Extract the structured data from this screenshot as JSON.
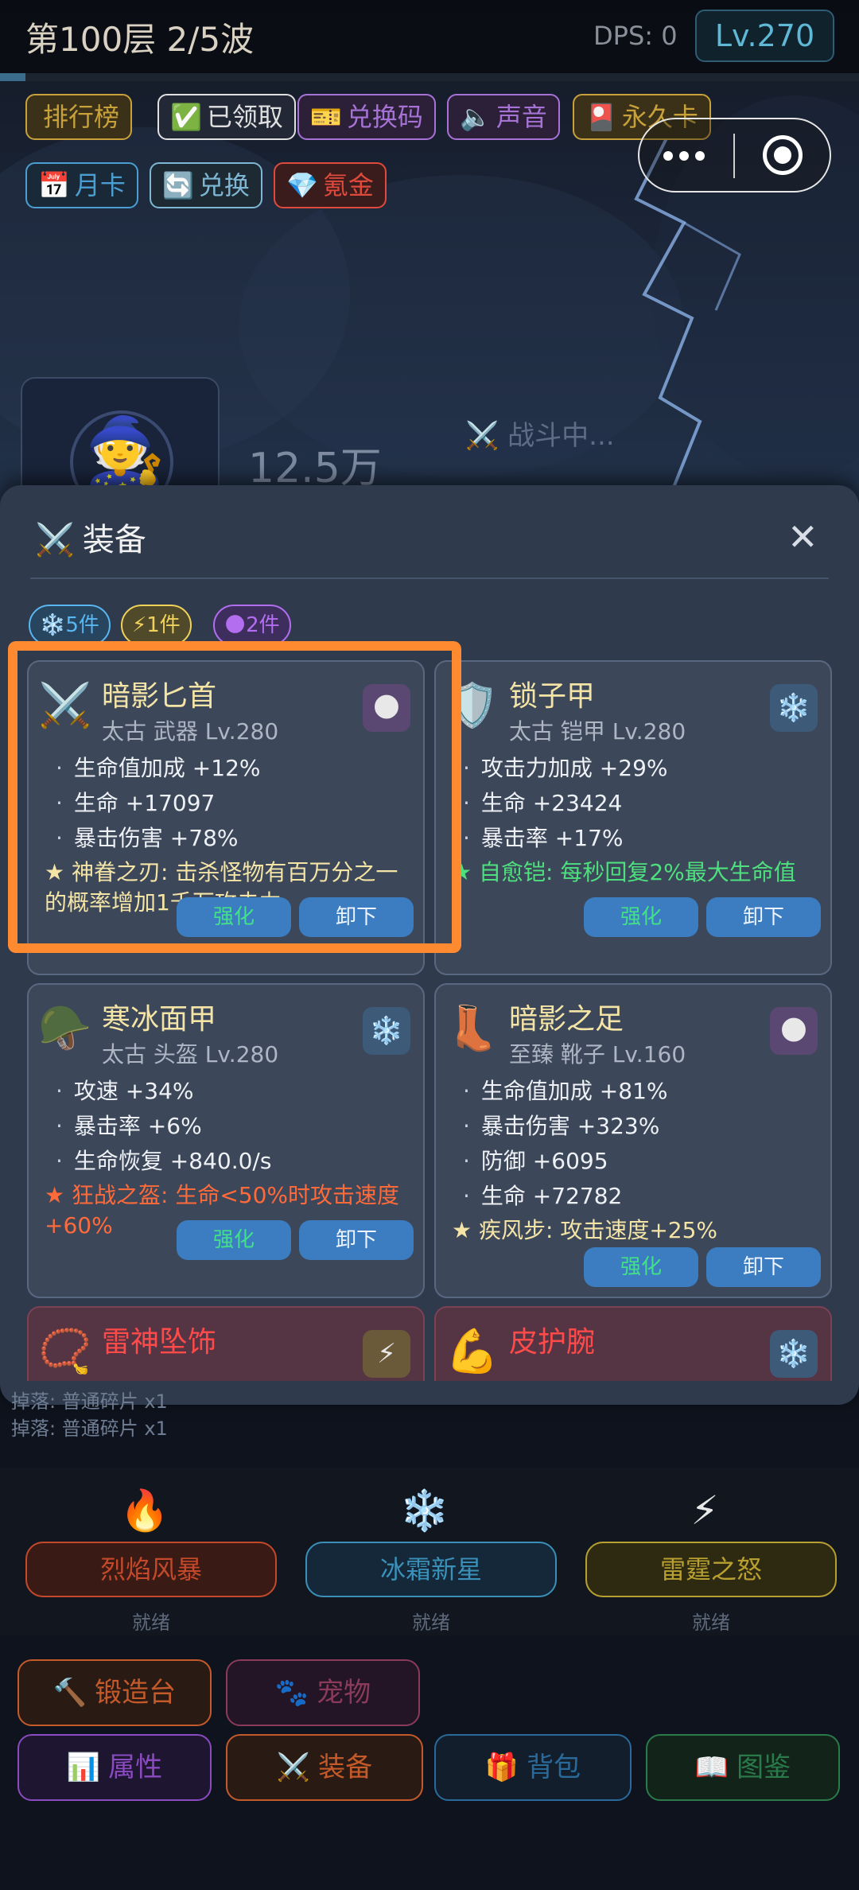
{
  "header": {
    "floor_wave": "第100层 2/5波",
    "dps": "DPS: 0",
    "level": "Lv.270",
    "wave_progress": 0.03
  },
  "top_buttons": [
    {
      "label": "排行榜",
      "icon": "trophy-icon",
      "glyph": "",
      "color": "#c8a13b",
      "bg": "#3a3118"
    },
    {
      "label": "已领取",
      "icon": "checkbox-icon",
      "glyph": "✅",
      "color": "#e0e0e0",
      "bg": "#222836"
    },
    {
      "label": "兑换码",
      "icon": "ticket-icon",
      "glyph": "🎫",
      "color": "#a772d6",
      "bg": "#2c2038"
    },
    {
      "label": "声音",
      "icon": "speaker-icon",
      "glyph": "🔈",
      "color": "#a772d6",
      "bg": "#2c2038"
    },
    {
      "label": "永久卡",
      "icon": "card-icon",
      "glyph": "🎴",
      "color": "#c8a13b",
      "bg": "#3a3118"
    },
    {
      "label": "月卡",
      "icon": "calendar-icon",
      "glyph": "📅",
      "color": "#4a9ed2",
      "bg": "#1a2938"
    },
    {
      "label": "兑换",
      "icon": "refresh-icon",
      "glyph": "🔄",
      "color": "#7eb7d3",
      "bg": "#1d2a33"
    },
    {
      "label": "氪金",
      "icon": "gem-icon",
      "glyph": "💎",
      "color": "#e04a3c",
      "bg": "#3a1c1c"
    }
  ],
  "scene": {
    "hero_avatar": "🧙",
    "power": "12.5万",
    "battle_status": "⚔️ 战斗中..."
  },
  "modal": {
    "title_icon": "⚔️",
    "title": "装备",
    "close": "✕",
    "set_chips": [
      {
        "icon": "snowflake-icon",
        "glyph": "❄️",
        "label": "5件",
        "color": "#58b6f0",
        "bg": "#284560"
      },
      {
        "icon": "lightning-icon",
        "glyph": "⚡",
        "label": "1件",
        "color": "#f0d25a",
        "bg": "#504a2a"
      },
      {
        "icon": "moon-icon",
        "glyph": "🌑",
        "label": "2件",
        "color": "#b36ef0",
        "bg": "#3e2e5e"
      }
    ],
    "cards": [
      {
        "name": "暗影匕首",
        "name_color": "#f4e4a6",
        "icon": "crossed-swords-icon",
        "glyph": "⚔️",
        "meta": "太古 武器  Lv.280",
        "set": "moon-icon",
        "set_glyph": "🌑",
        "set_bg": "#5a4872",
        "stats": [
          "生命值加成 +12%",
          "生命 +17097",
          "暴击伤害 +78%"
        ],
        "special": "★ 神眷之刃: 击杀怪物有百万分之一的概率增加1千万攻击力",
        "special_color": "#f4e4a6",
        "upgrade": "强化",
        "unequip": "卸下"
      },
      {
        "name": "锁子甲",
        "name_color": "#f4e4a6",
        "icon": "shield-icon",
        "glyph": "🛡️",
        "meta": "太古 铠甲  Lv.280",
        "set": "snowflake-icon",
        "set_glyph": "❄️",
        "set_bg": "#3d5a78",
        "stats": [
          "攻击力加成 +29%",
          "生命 +23424",
          "暴击率 +17%"
        ],
        "special": "★ 自愈铠: 每秒回复2%最大生命值",
        "special_color": "#4ee07e",
        "upgrade": "强化",
        "unequip": "卸下"
      },
      {
        "name": "寒冰面甲",
        "name_color": "#f4e4a6",
        "icon": "helmet-icon",
        "glyph": "🪖",
        "meta": "太古 头盔  Lv.280",
        "set": "snowflake-icon",
        "set_glyph": "❄️",
        "set_bg": "#3d5a78",
        "stats": [
          "攻速 +34%",
          "暴击率 +6%",
          "生命恢复 +840.0/s"
        ],
        "special": "★ 狂战之盔: 生命<50%时攻击速度+60%",
        "special_color": "#ff6a3a",
        "upgrade": "强化",
        "unequip": "卸下"
      },
      {
        "name": "暗影之足",
        "name_color": "#f4e4a6",
        "icon": "boot-icon",
        "glyph": "👢",
        "meta": "至臻 靴子  Lv.160",
        "set": "moon-icon",
        "set_glyph": "🌑",
        "set_bg": "#5a4872",
        "stats": [
          "生命值加成 +81%",
          "暴击伤害 +323%",
          "防御 +6095",
          "生命 +72782"
        ],
        "special": "★ 疾风步: 攻击速度+25%",
        "special_color": "#f4e4a6",
        "upgrade": "强化",
        "unequip": "卸下"
      },
      {
        "name": "雷神坠饰",
        "name_color": "#ff4a4a",
        "icon": "necklace-icon",
        "glyph": "📿",
        "meta": "",
        "set": "lightning-icon",
        "set_glyph": "⚡",
        "set_bg": "#6a5a3a",
        "stats": [],
        "special": "",
        "special_color": "#ffffff",
        "upgrade": "",
        "unequip": ""
      },
      {
        "name": "皮护腕",
        "name_color": "#ff4a4a",
        "icon": "bracer-icon",
        "glyph": "💪",
        "meta": "",
        "set": "snowflake-icon",
        "set_glyph": "❄️",
        "set_bg": "#3d5a78",
        "stats": [],
        "special": "",
        "special_color": "#ffffff",
        "upgrade": "",
        "unequip": ""
      }
    ]
  },
  "logs": [
    "掉落: 普通碎片 x1",
    "掉落: 普通碎片 x1"
  ],
  "skills": [
    {
      "icon": "fire-icon",
      "glyph": "🔥",
      "label": "烈焰风暴",
      "status": "就绪",
      "color": "#c4492a",
      "bg": "#3a1a14"
    },
    {
      "icon": "snowflake-icon",
      "glyph": "❄️",
      "label": "冰霜新星",
      "status": "就绪",
      "color": "#3a90b8",
      "bg": "#14283a"
    },
    {
      "icon": "lightning-icon",
      "glyph": "⚡",
      "label": "雷霆之怒",
      "status": "就绪",
      "color": "#b8a030",
      "bg": "#2e2a12"
    }
  ],
  "nav": [
    {
      "icon": "hammer-icon",
      "glyph": "🔨",
      "label": "锻造台",
      "color": "#c45a2a",
      "bg": "#2a1a14"
    },
    {
      "icon": "paw-icon",
      "glyph": "🐾",
      "label": "宠物",
      "color": "#8a3a5a",
      "bg": "#231526"
    },
    {
      "icon": "bar-chart-icon",
      "glyph": "📊",
      "label": "属性",
      "color": "#8a4ac0",
      "bg": "#1e1630"
    },
    {
      "icon": "swords-icon",
      "glyph": "⚔️",
      "label": "装备",
      "color": "#c45a2a",
      "bg": "#2a1a14"
    },
    {
      "icon": "gift-icon",
      "glyph": "🎁",
      "label": "背包",
      "color": "#2a6a9a",
      "bg": "#121e2c"
    },
    {
      "icon": "book-icon",
      "glyph": "📖",
      "label": "图鉴",
      "color": "#2a7a4a",
      "bg": "#12241a"
    }
  ]
}
